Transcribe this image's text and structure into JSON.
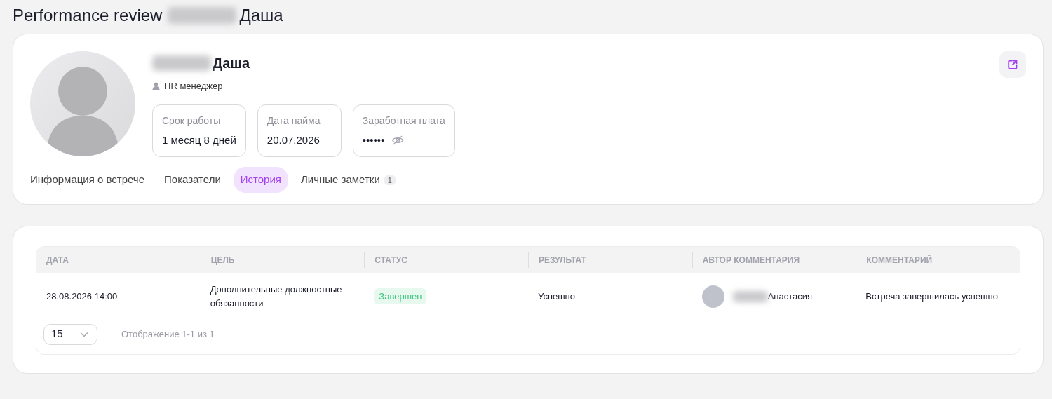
{
  "page_title": {
    "prefix": "Performance review",
    "name": "Даша",
    "name_redacted": true
  },
  "profile": {
    "name": "Даша",
    "name_redacted": true,
    "role": "HR менеджер",
    "stats": [
      {
        "kind": "text",
        "label": "Срок работы",
        "value": "1 месяц 8 дней"
      },
      {
        "kind": "text",
        "label": "Дата найма",
        "value": "20.07.2026"
      },
      {
        "kind": "masked",
        "label": "Заработная плата",
        "value": "••••••"
      }
    ]
  },
  "tabs": [
    {
      "label": "Информация о встрече",
      "selected": false
    },
    {
      "label": "Показатели",
      "selected": false
    },
    {
      "label": "История",
      "selected": true
    },
    {
      "label": "Личные заметки",
      "selected": false,
      "badge": "1"
    }
  ],
  "table": {
    "columns": [
      "ДАТА",
      "ЦЕЛЬ",
      "СТАТУС",
      "РЕЗУЛЬТАТ",
      "АВТОР КОММЕНТАРИЯ",
      "КОММЕНТАРИЙ"
    ],
    "rows": [
      {
        "date": "28.08.2026 14:00",
        "goal": "Дополнительные должностные обязанности",
        "status": {
          "text": "Завершен",
          "color": "#3cc47c"
        },
        "result": "Успешно",
        "author": "Анастасия",
        "author_redacted": true,
        "comment": "Встреча завершилась успешно"
      }
    ]
  },
  "pagination": {
    "page_size": "15",
    "summary": "Отображение 1-1 из 1"
  }
}
